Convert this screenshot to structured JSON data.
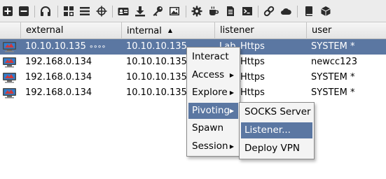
{
  "toolbar": {
    "buttons": [
      {
        "name": "add-icon"
      },
      {
        "name": "remove-icon"
      },
      {
        "name": "headphones-icon"
      },
      {
        "name": "pivot-graph-icon"
      },
      {
        "name": "session-list-icon"
      },
      {
        "name": "target-crosshair-icon"
      },
      {
        "name": "credentials-icon"
      },
      {
        "name": "download-icon"
      },
      {
        "name": "key-icon"
      },
      {
        "name": "screenshot-image-icon"
      },
      {
        "name": "gear-icon"
      },
      {
        "name": "coffee-icon"
      },
      {
        "name": "document-icon"
      },
      {
        "name": "console-icon"
      },
      {
        "name": "link-icon"
      },
      {
        "name": "cloud-icon"
      },
      {
        "name": "book-icon"
      },
      {
        "name": "cube-icon"
      }
    ]
  },
  "table": {
    "columns": [
      {
        "label": "",
        "key": "icon"
      },
      {
        "label": "external",
        "key": "external"
      },
      {
        "label": "internal",
        "key": "internal",
        "sorted": "asc"
      },
      {
        "label": "listener",
        "key": "listener"
      },
      {
        "label": "user",
        "key": "user"
      }
    ],
    "rows": [
      {
        "external": "10.10.10.135",
        "link_glyph": "∘∘∘∘",
        "internal": "10.10.10.135",
        "listener": "Lab_Https",
        "user": "SYSTEM *",
        "selected": true
      },
      {
        "external": "192.168.0.134",
        "link_glyph": "",
        "internal": "10.10.10.135",
        "listener": "Lab_Https",
        "user": "newcc123",
        "selected": false
      },
      {
        "external": "192.168.0.134",
        "link_glyph": "",
        "internal": "10.10.10.135",
        "listener": "Lab_Https",
        "user": "SYSTEM *",
        "selected": false
      },
      {
        "external": "192.168.0.134",
        "link_glyph": "",
        "internal": "10.10.10.135",
        "listener": "Lab_Https",
        "user": "SYSTEM *",
        "selected": false
      }
    ]
  },
  "context_menu": {
    "items": [
      {
        "label": "Interact",
        "submenu": false
      },
      {
        "label": "Access",
        "submenu": true
      },
      {
        "label": "Explore",
        "submenu": true
      },
      {
        "label": "Pivoting",
        "submenu": true,
        "active": true
      },
      {
        "label": "Spawn",
        "submenu": false
      },
      {
        "label": "Session",
        "submenu": true
      }
    ]
  },
  "pivoting_submenu": {
    "items": [
      {
        "label": "SOCKS Server",
        "hover": false
      },
      {
        "label": "Listener...",
        "hover": true
      },
      {
        "label": "Deploy VPN",
        "hover": false
      }
    ]
  },
  "colors": {
    "selection": "#5b77a2",
    "toolbar_icon": "#2b2b2b",
    "beacon_blue": "#2f7fd0",
    "beacon_red": "#d03a3a"
  }
}
